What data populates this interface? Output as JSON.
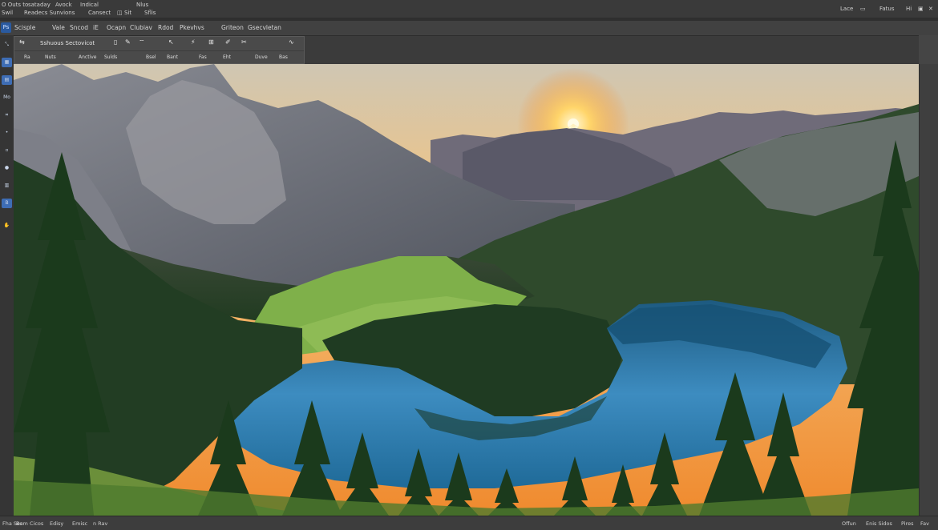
{
  "system_bar": {
    "row1": [
      "O Outs to",
      "sataday",
      "Avock",
      "Indical"
    ],
    "row2": [
      "Swil",
      "Readecs Sunvions",
      "Cansect"
    ],
    "status_tag": "Sit",
    "status_tag2": "Nlus",
    "status_tag3": "Sflis",
    "right_items": [
      "Lace",
      "Fatus",
      "Hi"
    ]
  },
  "menu_bar": {
    "logo": "Ps",
    "items": [
      "Scisple",
      "Vale",
      "Sncod",
      "iE",
      "Ocapn",
      "Clubiav",
      "Rdod",
      "Pkevhvs",
      "Griteon",
      "Gsecvletan"
    ]
  },
  "options_bar": {
    "row1_label": "Sshuous Sectovicot",
    "row2_items": [
      "Ra",
      "Nuts",
      "Anctive",
      "Sulds",
      "Bsel",
      "Bant",
      "Fas",
      "Eht",
      "Duve",
      "Bas"
    ]
  },
  "left_rail": {
    "buttons": [
      "",
      "",
      "",
      "Mo",
      "",
      "",
      "",
      "",
      "",
      ""
    ]
  },
  "status_bar": {
    "left_items": [
      "Fha Ses",
      "Bam",
      "Cicos",
      "Edisy",
      "Emisc",
      "n Rav"
    ],
    "right_items": [
      "Offun",
      "Enis Sidos",
      "Pires",
      "Fav"
    ]
  },
  "canvas": {
    "subject": "mountain-lake-sunset",
    "colors": {
      "sky_top": "#f3b56b",
      "sky_bottom": "#f4a347",
      "sun": "#fff3c6",
      "mountain_far": "#6a6877",
      "mountain_mid": "#4b5060",
      "forest_dark": "#203a22",
      "forest_mid": "#2f5a2c",
      "meadow": "#7fb04a",
      "lake": "#2d6f9a",
      "lake_light": "#6fb1d8"
    }
  }
}
